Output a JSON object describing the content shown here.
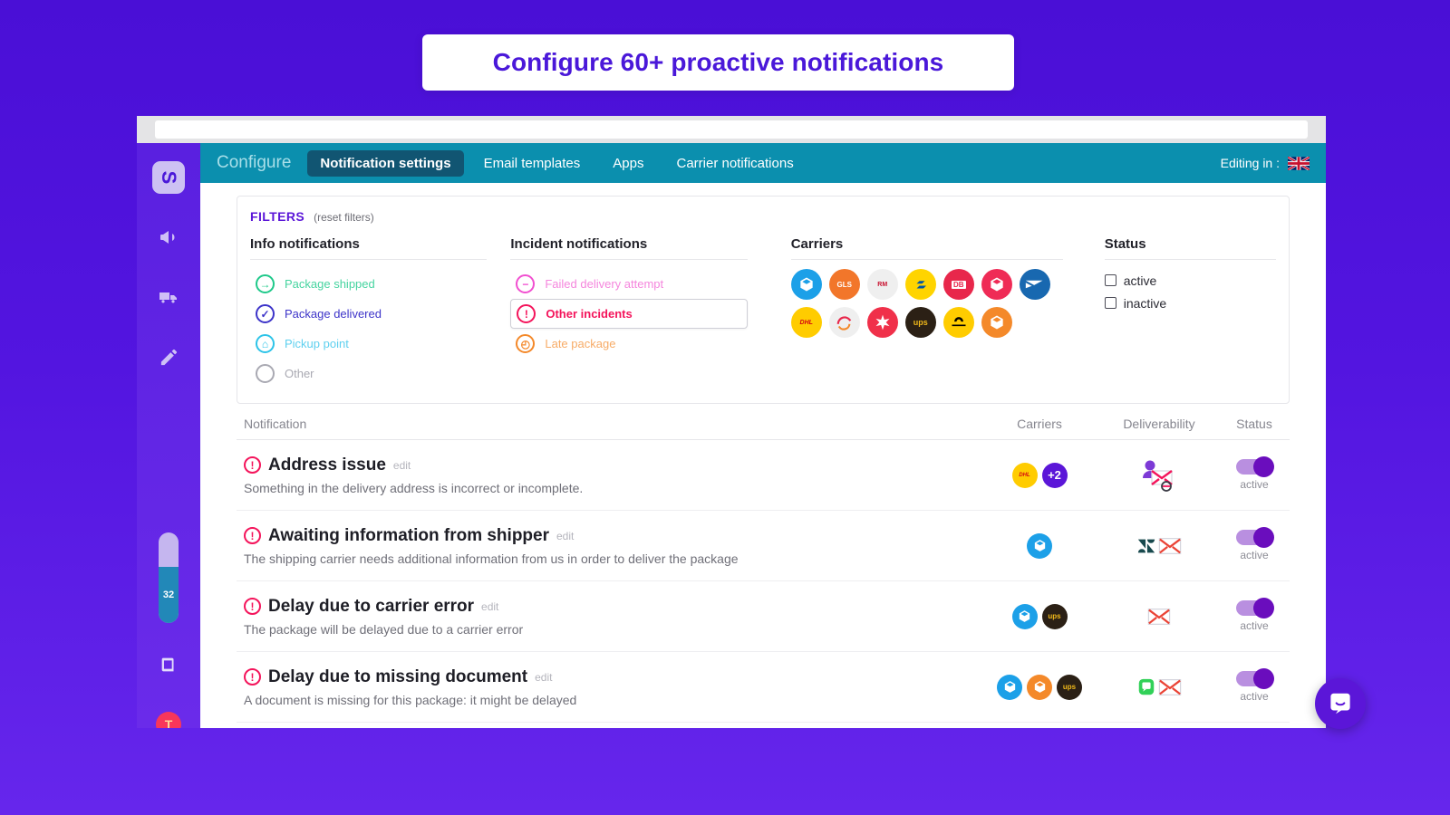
{
  "headline": {
    "text": "Configure 60+ proactive notifications"
  },
  "browser": {
    "url_value": ""
  },
  "sidebar": {
    "logo_letter": "S",
    "items": [
      {
        "name": "megaphone-icon"
      },
      {
        "name": "truck-icon"
      },
      {
        "name": "pencil-icon"
      },
      {
        "name": "book-icon"
      }
    ],
    "progress_label": "32",
    "avatar_letter": "T"
  },
  "topbar": {
    "brand": "Configure",
    "nav": [
      {
        "label": "Notification settings",
        "active": true
      },
      {
        "label": "Email templates",
        "active": false
      },
      {
        "label": "Apps",
        "active": false
      },
      {
        "label": "Carrier notifications",
        "active": false
      }
    ],
    "editing_label": "Editing in :",
    "flag": "uk-flag-icon"
  },
  "filters": {
    "title": "FILTERS",
    "reset_label": "(reset filters)",
    "info": {
      "title": "Info notifications",
      "items": [
        {
          "label": "Package shipped",
          "color": "#1fc98a",
          "glyph": "→",
          "selected": false
        },
        {
          "label": "Package delivered",
          "color": "#3d34c9",
          "glyph": "✓",
          "selected": false
        },
        {
          "label": "Pickup point",
          "color": "#2ec4e8",
          "glyph": "⌂",
          "selected": false
        },
        {
          "label": "Other",
          "color": "#a9a9b2",
          "glyph": "",
          "selected": false
        }
      ]
    },
    "incident": {
      "title": "Incident notifications",
      "items": [
        {
          "label": "Failed delivery attempt",
          "color": "#f14fd0",
          "glyph": "−",
          "selected": false
        },
        {
          "label": "Other incidents",
          "color": "#f4145b",
          "glyph": "!",
          "selected": true
        },
        {
          "label": "Late package",
          "color": "#f4892a",
          "glyph": "◴",
          "selected": false
        }
      ]
    },
    "carriers": {
      "title": "Carriers",
      "items": [
        {
          "name": "generic-carrier-blue",
          "bg": "#1ca0e8",
          "label": ""
        },
        {
          "name": "gls-carrier",
          "bg": "#f2762a",
          "label": "GLS"
        },
        {
          "name": "royal-mail-carrier",
          "bg": "#efefef",
          "label": "RM"
        },
        {
          "name": "la-poste-carrier",
          "bg": "#ffd400",
          "label": ""
        },
        {
          "name": "db-schenker-carrier",
          "bg": "#e8274b",
          "label": "DB"
        },
        {
          "name": "generic-carrier-red",
          "bg": "#ef2b56",
          "label": ""
        },
        {
          "name": "usps-carrier",
          "bg": "#1868b0",
          "label": ""
        },
        {
          "name": "dhl-carrier",
          "bg": "#ffcc00",
          "label": "DHL"
        },
        {
          "name": "chronopost-carrier",
          "bg": "#efefef",
          "label": ""
        },
        {
          "name": "colissimo-carrier",
          "bg": "#f0304a",
          "label": ""
        },
        {
          "name": "ups-carrier",
          "bg": "#2b2015",
          "label": "ups"
        },
        {
          "name": "deutsche-post-carrier",
          "bg": "#ffcc00",
          "label": ""
        },
        {
          "name": "generic-carrier-orange",
          "bg": "#f4892a",
          "label": ""
        }
      ]
    },
    "status": {
      "title": "Status",
      "items": [
        {
          "label": "active",
          "checked": false
        },
        {
          "label": "inactive",
          "checked": false
        }
      ]
    }
  },
  "table": {
    "headers": {
      "notification": "Notification",
      "carriers": "Carriers",
      "deliverability": "Deliverability",
      "status": "Status"
    },
    "edit_label": "edit",
    "rows": [
      {
        "title": "Address issue",
        "description": "Something in the delivery address is incorrect or incomplete.",
        "carriers": [
          {
            "name": "dhl-carrier",
            "bg": "#ffcc00",
            "label": "DHL"
          },
          {
            "name": "more-carriers-badge",
            "bg": "#5b16d8",
            "label": "+2"
          }
        ],
        "deliverability": [
          "person-envelope-icon"
        ],
        "status": "active"
      },
      {
        "title": "Awaiting information from shipper",
        "description": "The shipping carrier needs additional information from us in order to deliver the package",
        "carriers": [
          {
            "name": "generic-carrier-blue",
            "bg": "#1ca0e8",
            "label": ""
          }
        ],
        "deliverability": [
          "zendesk-icon",
          "email-icon"
        ],
        "status": "active"
      },
      {
        "title": "Delay due to carrier error",
        "description": "The package will be delayed due to a carrier error",
        "carriers": [
          {
            "name": "generic-carrier-blue",
            "bg": "#1ca0e8",
            "label": ""
          },
          {
            "name": "ups-carrier",
            "bg": "#2b2015",
            "label": "ups"
          }
        ],
        "deliverability": [
          "email-icon"
        ],
        "status": "active"
      },
      {
        "title": "Delay due to missing document",
        "description": "A document is missing for this package: it might be delayed",
        "carriers": [
          {
            "name": "generic-carrier-blue",
            "bg": "#1ca0e8",
            "label": ""
          },
          {
            "name": "generic-carrier-orange",
            "bg": "#f4892a",
            "label": ""
          },
          {
            "name": "ups-carrier",
            "bg": "#2b2015",
            "label": "ups"
          }
        ],
        "deliverability": [
          "sms-icon",
          "email-icon"
        ],
        "status": "active"
      }
    ]
  },
  "chat": {
    "name": "intercom-chat-launcher"
  },
  "colors": {
    "background_top": "#4a0fd6",
    "background_bottom": "#6626ec",
    "accent_purple": "#5b16d8",
    "topbar_teal": "#0b8fae",
    "active_tab": "#115572",
    "alert_red": "#f4145b"
  }
}
